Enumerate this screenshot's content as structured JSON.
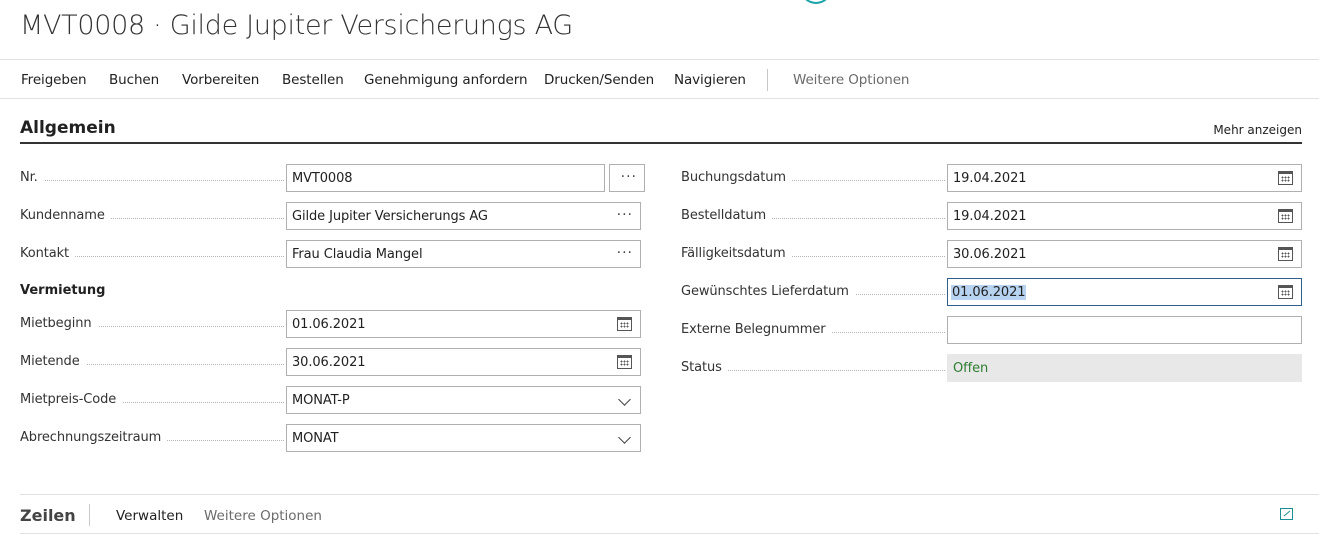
{
  "page": {
    "title": "MVT0008 · Gilde Jupiter Versicherungs AG"
  },
  "actions": [
    {
      "label": "Freigeben"
    },
    {
      "label": "Buchen"
    },
    {
      "label": "Vorbereiten"
    },
    {
      "label": "Bestellen"
    },
    {
      "label": "Genehmigung anfordern"
    },
    {
      "label": "Drucken/Senden"
    },
    {
      "label": "Navigieren"
    }
  ],
  "actions_more": "Weitere Optionen",
  "general": {
    "title": "Allgemein",
    "show_more": "Mehr anzeigen",
    "left": {
      "nr": {
        "label": "Nr.",
        "value": "MVT0008"
      },
      "customer_name": {
        "label": "Kundenname",
        "value": "Gilde Jupiter Versicherungs AG"
      },
      "contact": {
        "label": "Kontakt",
        "value": "Frau Claudia Mangel"
      }
    },
    "rental": {
      "title": "Vermietung",
      "start": {
        "label": "Mietbeginn",
        "value": "01.06.2021"
      },
      "end": {
        "label": "Mietende",
        "value": "30.06.2021"
      },
      "price_code": {
        "label": "Mietpreis-Code",
        "value": "MONAT-P"
      },
      "billing_period": {
        "label": "Abrechnungszeitraum",
        "value": "MONAT"
      }
    },
    "right": {
      "posting_date": {
        "label": "Buchungsdatum",
        "value": "19.04.2021"
      },
      "order_date": {
        "label": "Bestelldatum",
        "value": "19.04.2021"
      },
      "due_date": {
        "label": "Fälligkeitsdatum",
        "value": "30.06.2021"
      },
      "requested_delivery": {
        "label": "Gewünschtes Lieferdatum",
        "value": "01.06.2021"
      },
      "external_doc": {
        "label": "Externe Belegnummer",
        "value": ""
      },
      "status": {
        "label": "Status",
        "value": "Offen"
      }
    }
  },
  "lines": {
    "title": "Zeilen",
    "manage": "Verwalten",
    "more": "Weitere Optionen"
  },
  "colors": {
    "status_text": "#2e7d32",
    "accent": "#1a8f96",
    "selection": "#b7d3f0"
  },
  "icons": {
    "calendar": "calendar-icon",
    "lookup": "ellipsis-icon",
    "dropdown": "chevron-down-icon",
    "expand": "expand-icon"
  }
}
